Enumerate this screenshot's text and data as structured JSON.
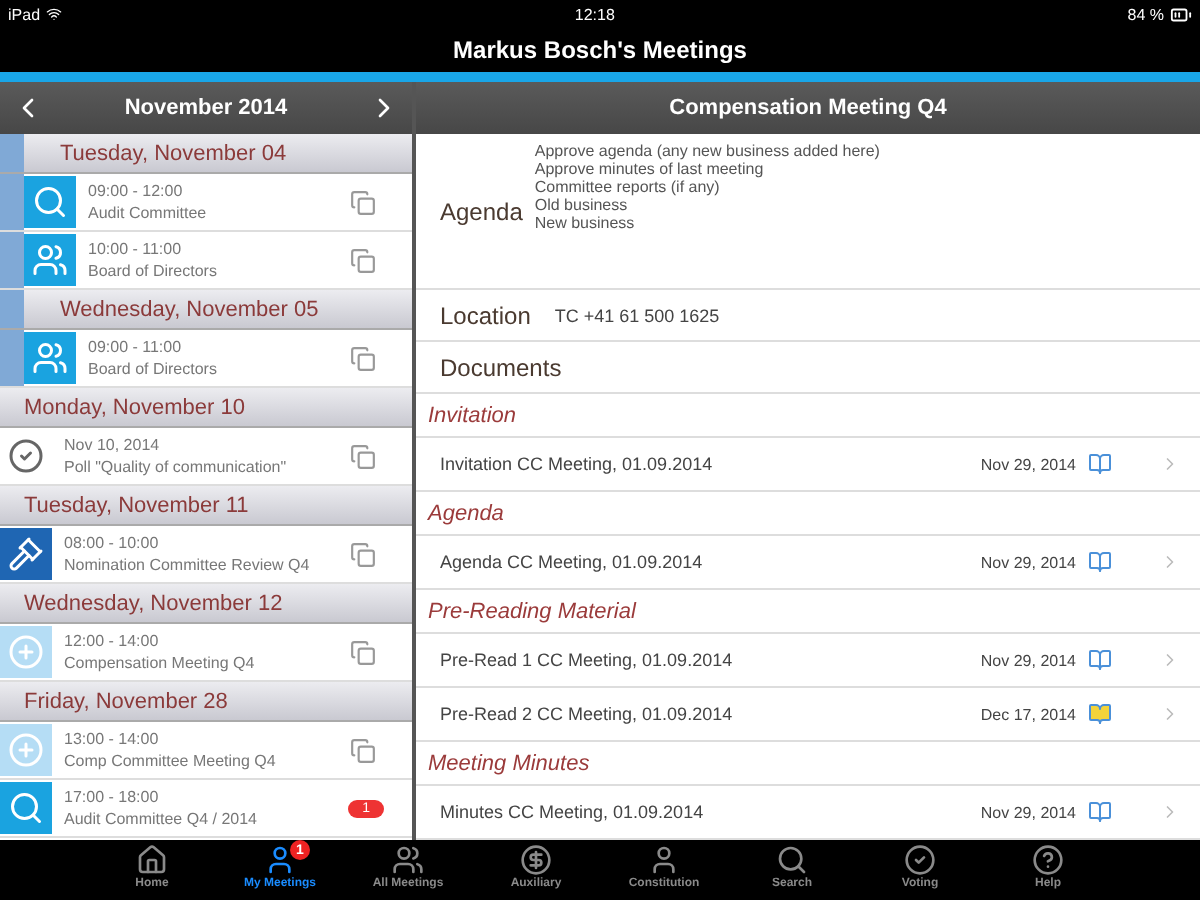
{
  "status_bar": {
    "device": "iPad",
    "time": "12:18",
    "battery": "84 %"
  },
  "title": "Markus Bosch's Meetings",
  "calendar": {
    "month": "November 2014",
    "days": [
      {
        "label": "Tuesday, November 04",
        "marked": true,
        "meetings": [
          {
            "kind": "audit",
            "time": "09:00 - 12:00",
            "title": "Audit Committee"
          },
          {
            "kind": "board",
            "time": "10:00 - 11:00",
            "title": "Board of Directors"
          }
        ]
      },
      {
        "label": "Wednesday, November 05",
        "marked": true,
        "meetings": [
          {
            "kind": "board",
            "time": "09:00 - 11:00",
            "title": "Board of Directors"
          }
        ]
      },
      {
        "label": "Monday, November 10",
        "marked": false,
        "meetings": [
          {
            "kind": "poll",
            "time": "Nov 10, 2014",
            "title": "Poll \"Quality of communication\""
          }
        ]
      },
      {
        "label": "Tuesday, November 11",
        "marked": false,
        "meetings": [
          {
            "kind": "nomination",
            "time": "08:00 - 10:00",
            "title": "Nomination Committee Review Q4"
          }
        ]
      },
      {
        "label": "Wednesday, November 12",
        "marked": false,
        "meetings": [
          {
            "kind": "compensation",
            "time": "12:00 - 14:00",
            "title": "Compensation Meeting Q4"
          }
        ]
      },
      {
        "label": "Friday, November 28",
        "marked": false,
        "meetings": [
          {
            "kind": "compensation",
            "time": "13:00 - 14:00",
            "title": "Comp Committee Meeting Q4"
          },
          {
            "kind": "audit",
            "time": "17:00 - 18:00",
            "title": "Audit Committee Q4 / 2014",
            "badge": "1"
          }
        ]
      }
    ]
  },
  "detail": {
    "title": "Compensation Meeting Q4",
    "agenda_label": "Agenda",
    "agenda_items": [
      "Approve agenda (any new business added here)",
      "Approve minutes of last meeting",
      "Committee reports (if any)",
      "Old business",
      "New business"
    ],
    "location_label": "Location",
    "location": "TC +41 61 500 1625",
    "documents_label": "Documents",
    "document_groups": [
      {
        "name": "Invitation",
        "documents": [
          {
            "title": "Invitation CC Meeting, 01.09.2014",
            "date": "Nov 29, 2014",
            "annotated": false
          }
        ]
      },
      {
        "name": "Agenda",
        "documents": [
          {
            "title": "Agenda CC Meeting, 01.09.2014",
            "date": "Nov 29, 2014",
            "annotated": false
          }
        ]
      },
      {
        "name": "Pre-Reading Material",
        "documents": [
          {
            "title": "Pre-Read  1 CC Meeting, 01.09.2014",
            "date": "Nov 29, 2014",
            "annotated": false
          },
          {
            "title": "Pre-Read  2 CC Meeting, 01.09.2014",
            "date": "Dec 17, 2014",
            "annotated": true
          }
        ]
      },
      {
        "name": "Meeting Minutes",
        "documents": [
          {
            "title": "Minutes CC Meeting, 01.09.2014",
            "date": "Nov 29, 2014",
            "annotated": false
          }
        ]
      }
    ]
  },
  "tabs": [
    {
      "label": "Home",
      "selected": false
    },
    {
      "label": "My Meetings",
      "selected": true,
      "badge": "1"
    },
    {
      "label": "All Meetings",
      "selected": false
    },
    {
      "label": "Auxiliary",
      "selected": false
    },
    {
      "label": "Constitution",
      "selected": false
    },
    {
      "label": "Search",
      "selected": false
    },
    {
      "label": "Voting",
      "selected": false
    },
    {
      "label": "Help",
      "selected": false
    }
  ]
}
